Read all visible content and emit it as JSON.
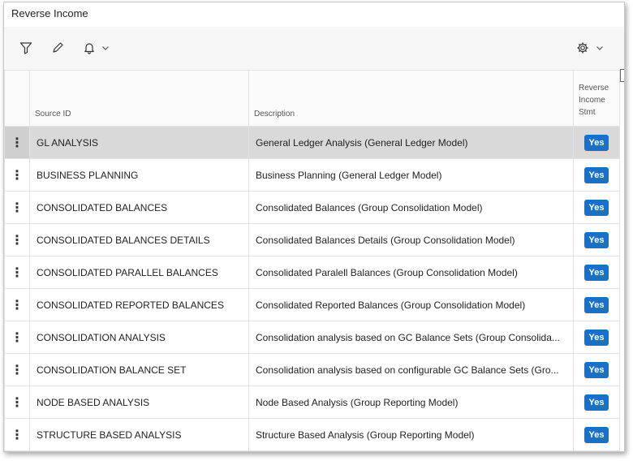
{
  "window": {
    "title": "Reverse Income"
  },
  "toolbar": {
    "filter_icon": "filter-icon",
    "edit_icon": "pencil-icon",
    "bell_icon": "bell-icon",
    "settings_icon": "gear-icon"
  },
  "table": {
    "columns": {
      "source_id": "Source ID",
      "description": "Description",
      "stmt_line1": "Reverse",
      "stmt_line2": "Income",
      "stmt_line3": "Stmt"
    },
    "rows": [
      {
        "menu": "⋮",
        "source_id": "GL ANALYSIS",
        "description": "General Ledger Analysis (General Ledger Model)",
        "stmt": "Yes"
      },
      {
        "menu": "⋮",
        "source_id": "BUSINESS PLANNING",
        "description": "Business Planning (General Ledger Model)",
        "stmt": "Yes"
      },
      {
        "menu": "⋮",
        "source_id": "CONSOLIDATED BALANCES",
        "description": "Consolidated Balances (Group Consolidation Model)",
        "stmt": "Yes"
      },
      {
        "menu": "⋮",
        "source_id": "CONSOLIDATED BALANCES DETAILS",
        "description": "Consolidated Balances Details (Group Consolidation Model)",
        "stmt": "Yes"
      },
      {
        "menu": "⋮",
        "source_id": "CONSOLIDATED PARALLEL BALANCES",
        "description": "Consolidated Paralell Balances (Group Consolidation Model)",
        "stmt": "Yes"
      },
      {
        "menu": "⋮",
        "source_id": "CONSOLIDATED REPORTED BALANCES",
        "description": "Consolidated Reported Balances (Group Consolidation Model)",
        "stmt": "Yes"
      },
      {
        "menu": "⋮",
        "source_id": "CONSOLIDATION ANALYSIS",
        "description": "Consolidation analysis based on GC Balance Sets (Group Consolida...",
        "stmt": "Yes"
      },
      {
        "menu": "⋮",
        "source_id": "CONSOLIDATION BALANCE SET",
        "description": "Consolidation analysis based on configurable GC Balance Sets (Gro...",
        "stmt": "Yes"
      },
      {
        "menu": "⋮",
        "source_id": "NODE BASED ANALYSIS",
        "description": "Node Based Analysis (Group Reporting Model)",
        "stmt": "Yes"
      },
      {
        "menu": "⋮",
        "source_id": "STRUCTURE BASED ANALYSIS",
        "description": "Structure Based Analysis (Group Reporting Model)",
        "stmt": "Yes"
      }
    ],
    "selected_row": 0
  },
  "colors": {
    "accent": "#1a6fc8",
    "selected_row": "#d9d9d9",
    "toolbar_bg": "#f7f7f7"
  }
}
